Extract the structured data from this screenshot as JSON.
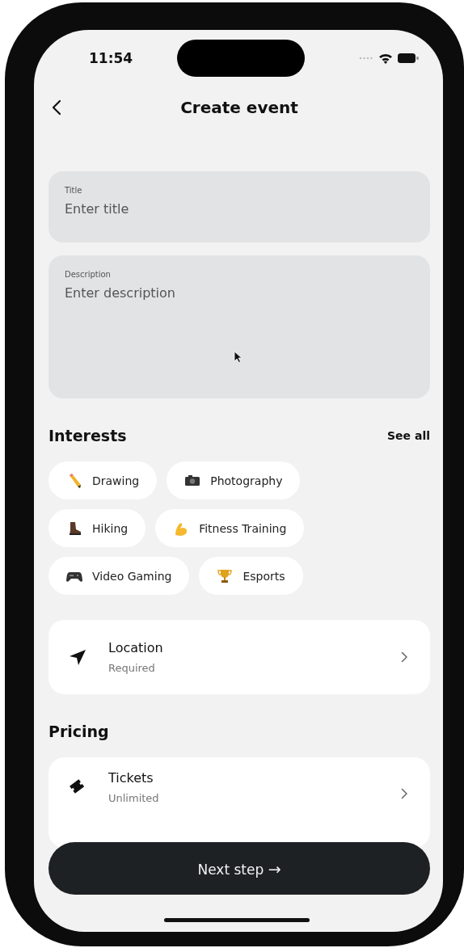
{
  "status_bar": {
    "time": "11:54"
  },
  "header": {
    "title": "Create event"
  },
  "fields": [
    {
      "kind": "single",
      "label": "Title",
      "placeholder": "Enter title"
    },
    {
      "kind": "multi",
      "label": "Description",
      "placeholder": "Enter description"
    }
  ],
  "interests": {
    "title": "Interests",
    "action": "See all",
    "chips": [
      {
        "label": "Drawing",
        "kind": "pencil"
      },
      {
        "label": "Photography",
        "kind": "camera"
      },
      {
        "label": "Hiking",
        "kind": "boot"
      },
      {
        "label": "Fitness Training",
        "kind": "arm"
      },
      {
        "label": "Video Gaming",
        "kind": "gamepad"
      },
      {
        "label": "Esports",
        "kind": "trophy"
      }
    ]
  },
  "location": {
    "title": "Location",
    "subtitle": "Required"
  },
  "pricing": {
    "title": "Pricing",
    "items": [
      {
        "title": "Tickets",
        "subtitle": "Unlimited"
      }
    ]
  },
  "next_button": {
    "label": "Next step",
    "arrow": "→"
  }
}
